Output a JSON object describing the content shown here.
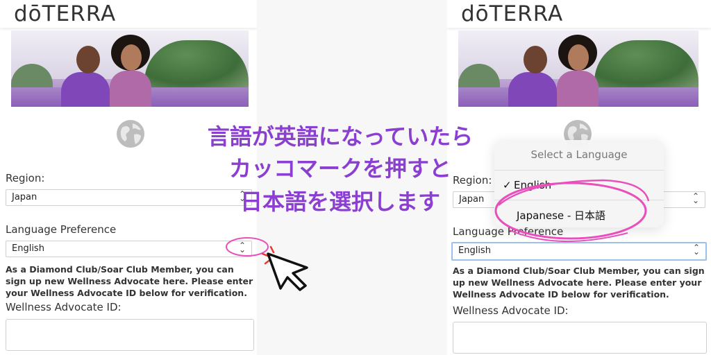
{
  "brand": {
    "logo": "dōTERRA"
  },
  "colors": {
    "accent_purple": "#8a3fd0",
    "highlight_pink": "#e84fbc",
    "focus_blue": "#9cc0ea"
  },
  "left": {
    "region_label": "Region:",
    "region_value": "Japan",
    "language_label": "Language Preference",
    "language_value": "English",
    "info": "As a Diamond Club/Soar Club Member, you can sign up new Wellness Advocate here. Please enter your Wellness Advocate ID below for verification.",
    "wa_label": "Wellness Advocate ID:",
    "wa_value": ""
  },
  "right": {
    "region_label": "Region:",
    "region_value": "Japan",
    "language_label": "Language Preference",
    "language_value": "English",
    "info": "As a Diamond Club/Soar Club Member, you can sign up new Wellness Advocate here. Please enter your Wellness Advocate ID below for verification.",
    "wa_label": "Wellness Advocate ID:",
    "wa_value": ""
  },
  "dropdown": {
    "title": "Select a Language",
    "options": [
      {
        "label": "English",
        "selected": true
      },
      {
        "label": "Japanese - 日本語",
        "selected": false
      }
    ],
    "check_glyph": "✓"
  },
  "overlay": {
    "line1": "言語が英語になっていたら",
    "line2": "カッコマークを押すと",
    "line3": "日本語を選択します"
  },
  "icons": [
    "globe-icon",
    "chevron-updown-icon",
    "cursor-arrow-icon",
    "checkmark-icon"
  ]
}
